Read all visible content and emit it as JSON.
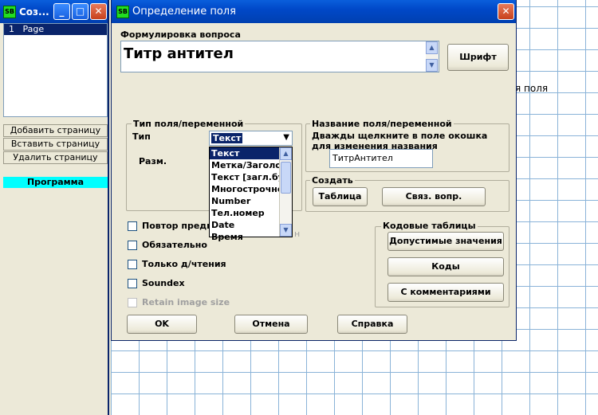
{
  "left_window": {
    "title": "Соз...",
    "minimize": "_",
    "maximize": "□",
    "close": "✕",
    "pages": [
      {
        "num": "1",
        "name": "Page"
      }
    ],
    "buttons": {
      "add": "Добавить страницу",
      "insert": "Вставить страницу",
      "delete": "Удалить страницу"
    },
    "program_label": "Программа"
  },
  "background_text": "я поля",
  "dialog": {
    "title": "Определение поля",
    "close": "✕",
    "question_label": "Формулировка вопроса",
    "question_text": "Титр антител",
    "font_button": "Шрифт",
    "type_group": {
      "legend": "Тип поля/переменной",
      "type_label": "Тип",
      "selected": "Текст",
      "size_label": "Разм.",
      "options": [
        "Текст",
        "Метка/Заголовок",
        "Текст [загл.буквы]",
        "Многострочное",
        "Number",
        "Тел.номер",
        "Date",
        "Время"
      ],
      "partial_hidden_text": "н"
    },
    "name_group": {
      "legend": "Название поля/переменной",
      "hint": "Дважды щелкните в поле окошка для изменения названия",
      "value": "ТитрАнтител"
    },
    "create_group": {
      "legend": "Создать",
      "table_button": "Таблица",
      "link_button": "Связ. вопр."
    },
    "checkboxes": {
      "repeat": "Повтор предыд",
      "required": "Обязательно",
      "readonly": "Только д/чтения",
      "soundex": "Soundex",
      "retain": "Retain image size"
    },
    "codes_group": {
      "legend": "Кодовые таблицы",
      "allowed": "Допустимые значения",
      "codes": "Коды",
      "comments": "С комментариями"
    },
    "ok": "OK",
    "cancel": "Отмена",
    "help": "Справка"
  }
}
